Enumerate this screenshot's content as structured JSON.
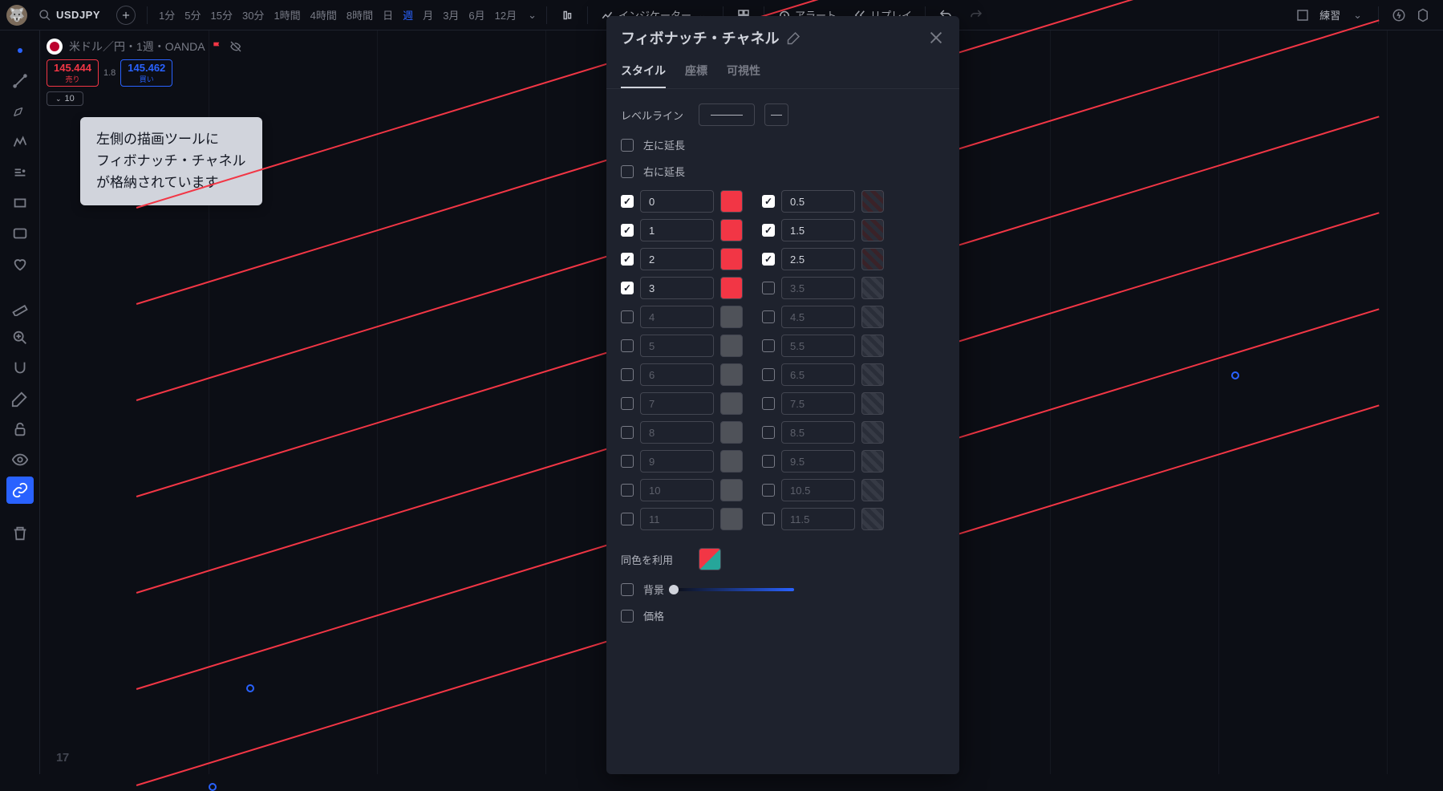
{
  "topbar": {
    "symbol": "USDJPY",
    "timeframes": [
      "1分",
      "5分",
      "15分",
      "30分",
      "1時間",
      "4時間",
      "8時間",
      "日",
      "週",
      "月",
      "3月",
      "6月",
      "12月"
    ],
    "active_tf": "週",
    "indicator_btn": "インジケーター",
    "alert_btn": "アラート",
    "replay_btn": "リプレイ",
    "practice_btn": "練習"
  },
  "chart": {
    "symbol_info": "米ドル／円・1週・OANDA",
    "sell_price": "145.444",
    "sell_label": "売り",
    "spread": "1.8",
    "buy_price": "145.462",
    "buy_label": "買い",
    "qty_label": "10"
  },
  "annotation": {
    "line1": "左側の描画ツールに",
    "line2": "フィボナッチ・チャネル",
    "line3": "が格納されています"
  },
  "dialog": {
    "title": "フィボナッチ・チャネル",
    "tabs": [
      "スタイル",
      "座標",
      "可視性"
    ],
    "active_tab": "スタイル",
    "level_line_label": "レベルライン",
    "extend_left": "左に延長",
    "extend_right": "右に延長",
    "levels_left": [
      {
        "checked": true,
        "val": "0",
        "c": "red"
      },
      {
        "checked": true,
        "val": "1",
        "c": "red"
      },
      {
        "checked": true,
        "val": "2",
        "c": "red"
      },
      {
        "checked": true,
        "val": "3",
        "c": "red"
      },
      {
        "checked": false,
        "val": "4",
        "c": "dim"
      },
      {
        "checked": false,
        "val": "5",
        "c": "dim"
      },
      {
        "checked": false,
        "val": "6",
        "c": "dim"
      },
      {
        "checked": false,
        "val": "7",
        "c": "dim"
      },
      {
        "checked": false,
        "val": "8",
        "c": "dim"
      },
      {
        "checked": false,
        "val": "9",
        "c": "dim"
      },
      {
        "checked": false,
        "val": "10",
        "c": "dim"
      },
      {
        "checked": false,
        "val": "11",
        "c": "dim"
      }
    ],
    "levels_right": [
      {
        "checked": true,
        "val": "0.5",
        "c": "hatch"
      },
      {
        "checked": true,
        "val": "1.5",
        "c": "hatch"
      },
      {
        "checked": true,
        "val": "2.5",
        "c": "hatch"
      },
      {
        "checked": false,
        "val": "3.5",
        "c": "hatchdim"
      },
      {
        "checked": false,
        "val": "4.5",
        "c": "hatchdim"
      },
      {
        "checked": false,
        "val": "5.5",
        "c": "hatchdim"
      },
      {
        "checked": false,
        "val": "6.5",
        "c": "hatchdim"
      },
      {
        "checked": false,
        "val": "7.5",
        "c": "hatchdim"
      },
      {
        "checked": false,
        "val": "8.5",
        "c": "hatchdim"
      },
      {
        "checked": false,
        "val": "9.5",
        "c": "hatchdim"
      },
      {
        "checked": false,
        "val": "10.5",
        "c": "hatchdim"
      },
      {
        "checked": false,
        "val": "11.5",
        "c": "hatchdim"
      }
    ],
    "same_color_label": "同色を利用",
    "background_label": "背景",
    "price_label": "価格"
  },
  "logo": "17"
}
